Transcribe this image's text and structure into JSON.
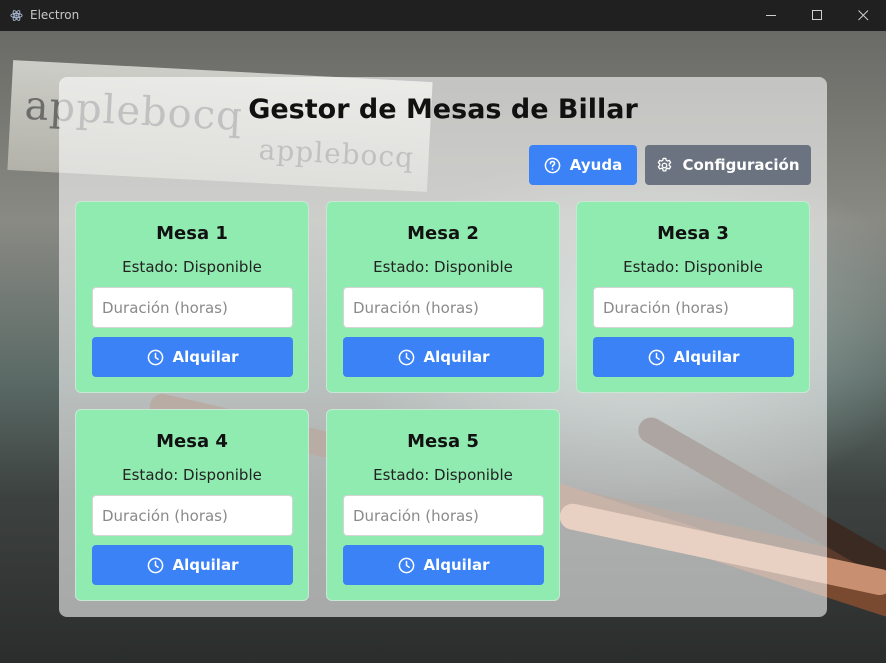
{
  "window": {
    "title": "Electron",
    "controls": [
      "minimize-icon",
      "maximize-icon",
      "close-icon"
    ]
  },
  "header": {
    "title": "Gestor de Mesas de Billar"
  },
  "toolbar": {
    "help_label": "Ayuda",
    "help_icon": "question-circle-icon",
    "config_label": "Configuración",
    "config_icon": "gear-icon"
  },
  "tables": [
    {
      "name": "Mesa 1",
      "status": "Estado: Disponible",
      "placeholder": "Duración (horas)",
      "button": "Alquilar"
    },
    {
      "name": "Mesa 2",
      "status": "Estado: Disponible",
      "placeholder": "Duración (horas)",
      "button": "Alquilar"
    },
    {
      "name": "Mesa 3",
      "status": "Estado: Disponible",
      "placeholder": "Duración (horas)",
      "button": "Alquilar"
    },
    {
      "name": "Mesa 4",
      "status": "Estado: Disponible",
      "placeholder": "Duración (horas)",
      "button": "Alquilar"
    },
    {
      "name": "Mesa 5",
      "status": "Estado: Disponible",
      "placeholder": "Duración (horas)",
      "button": "Alquilar"
    }
  ],
  "background_banner": {
    "text_1": "applebocq",
    "text_2": "applebocq"
  },
  "colors": {
    "primary": "#3b82f6",
    "secondary": "#6b7280",
    "card": "#90ebb0",
    "titlebar": "#202020"
  }
}
